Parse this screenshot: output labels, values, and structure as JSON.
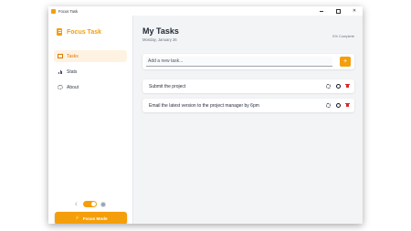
{
  "window": {
    "title": "Focus Task",
    "controls": [
      "minimize",
      "maximize",
      "close"
    ]
  },
  "sidebar": {
    "brand": "Focus Task",
    "items": [
      {
        "label": "Tasks",
        "icon": "list-icon",
        "active": true
      },
      {
        "label": "Stats",
        "icon": "bar-chart-icon",
        "active": false
      },
      {
        "label": "About",
        "icon": "gear-icon",
        "active": false
      }
    ],
    "theme_toggle": {
      "dark_mode": true
    },
    "focus_button": "Focus Mode"
  },
  "main": {
    "title": "My Tasks",
    "date": "Monday, January 26",
    "progress": "0% Complete",
    "add": {
      "placeholder": "Add a new task...",
      "value": "",
      "button": "+"
    },
    "tasks": [
      {
        "text": "Submit the project"
      },
      {
        "text": "Email the latest version to the project manager by 6pm"
      }
    ]
  },
  "colors": {
    "accent": "#f59e0b",
    "active_bg": "#fef3e2",
    "delete": "#dc2626"
  }
}
